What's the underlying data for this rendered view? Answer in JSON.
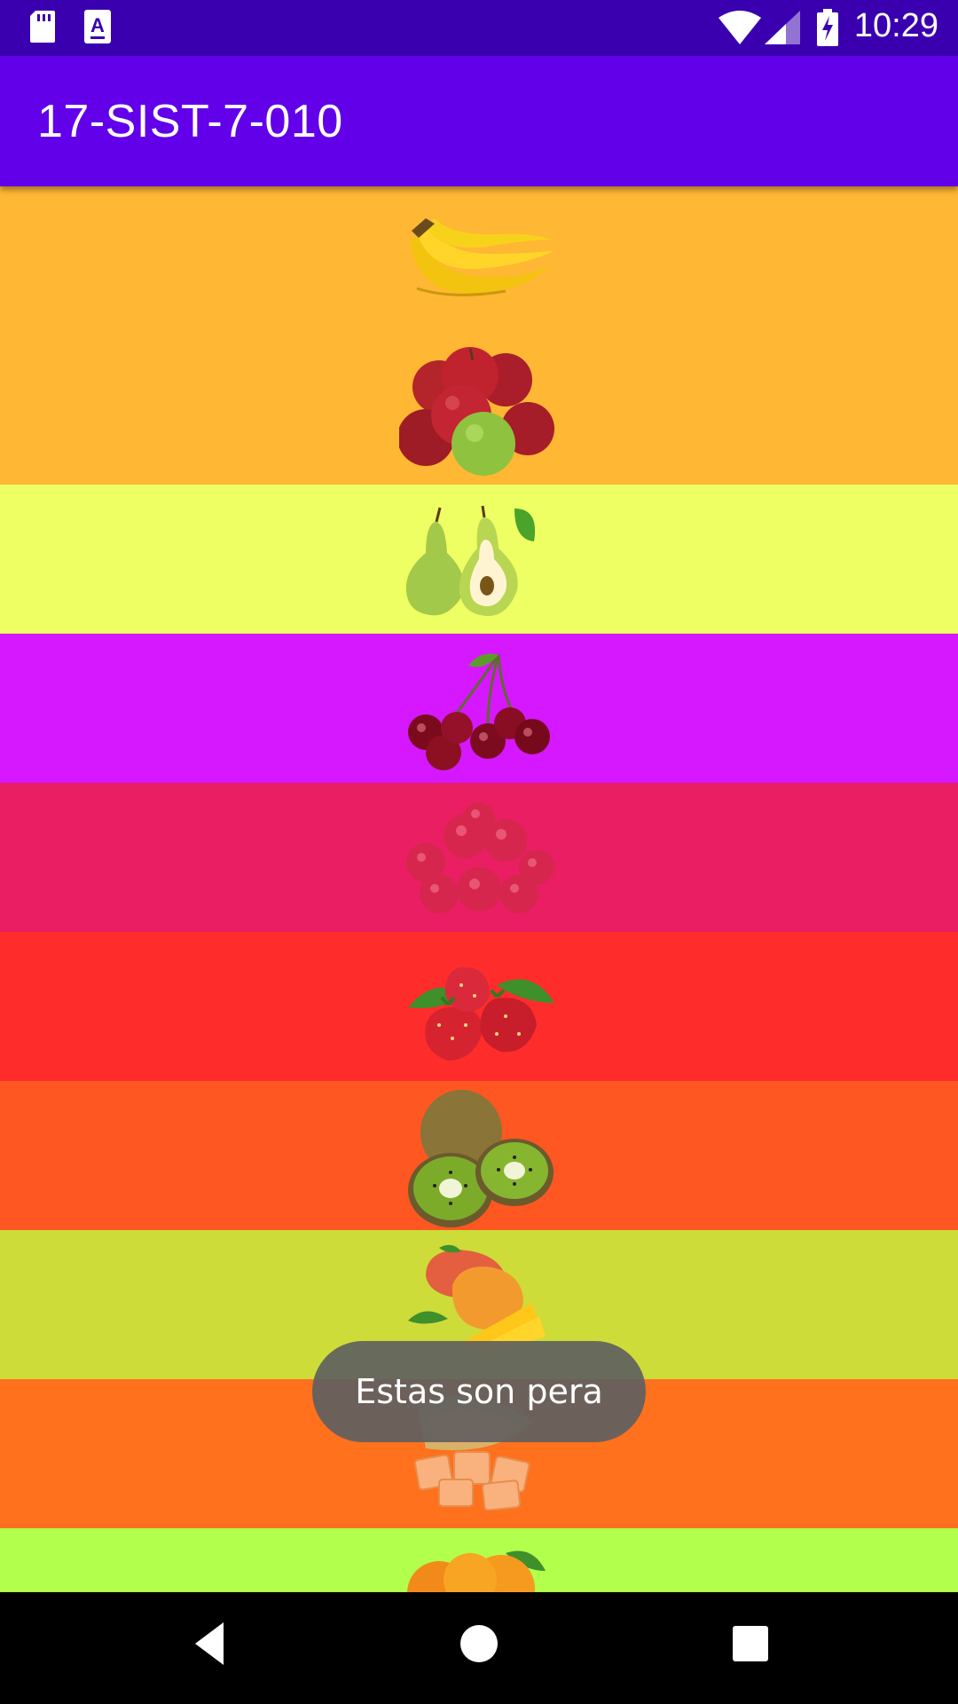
{
  "status_bar": {
    "time": "10:29",
    "icons": [
      "sd-card-icon",
      "app-notification-icon",
      "wifi-icon",
      "signal-icon",
      "battery-charging-icon"
    ]
  },
  "app_bar": {
    "title": "17-SIST-7-010"
  },
  "list": {
    "items": [
      {
        "fruit": "banana-icon",
        "bg": "#ffb734"
      },
      {
        "fruit": "apple-icon",
        "bg": "#ffb734"
      },
      {
        "fruit": "pear-icon",
        "bg": "#eeff63"
      },
      {
        "fruit": "cherry-icon",
        "bg": "#d518ff"
      },
      {
        "fruit": "raspberry-icon",
        "bg": "#e91e63"
      },
      {
        "fruit": "strawberry-icon",
        "bg": "#ff2c2c"
      },
      {
        "fruit": "kiwi-icon",
        "bg": "#ff5722"
      },
      {
        "fruit": "mango-icon",
        "bg": "#cddc39"
      },
      {
        "fruit": "melon-icon",
        "bg": "#ff711c"
      },
      {
        "fruit": "orange-icon",
        "bg": "#b2ff4c"
      }
    ]
  },
  "toast": {
    "message": "Estas son pera"
  },
  "nav_bar": {
    "buttons": [
      "back-icon",
      "home-icon",
      "recents-icon"
    ]
  },
  "colors": {
    "status_bar": "#3a00b0",
    "app_bar": "#6200ea"
  }
}
